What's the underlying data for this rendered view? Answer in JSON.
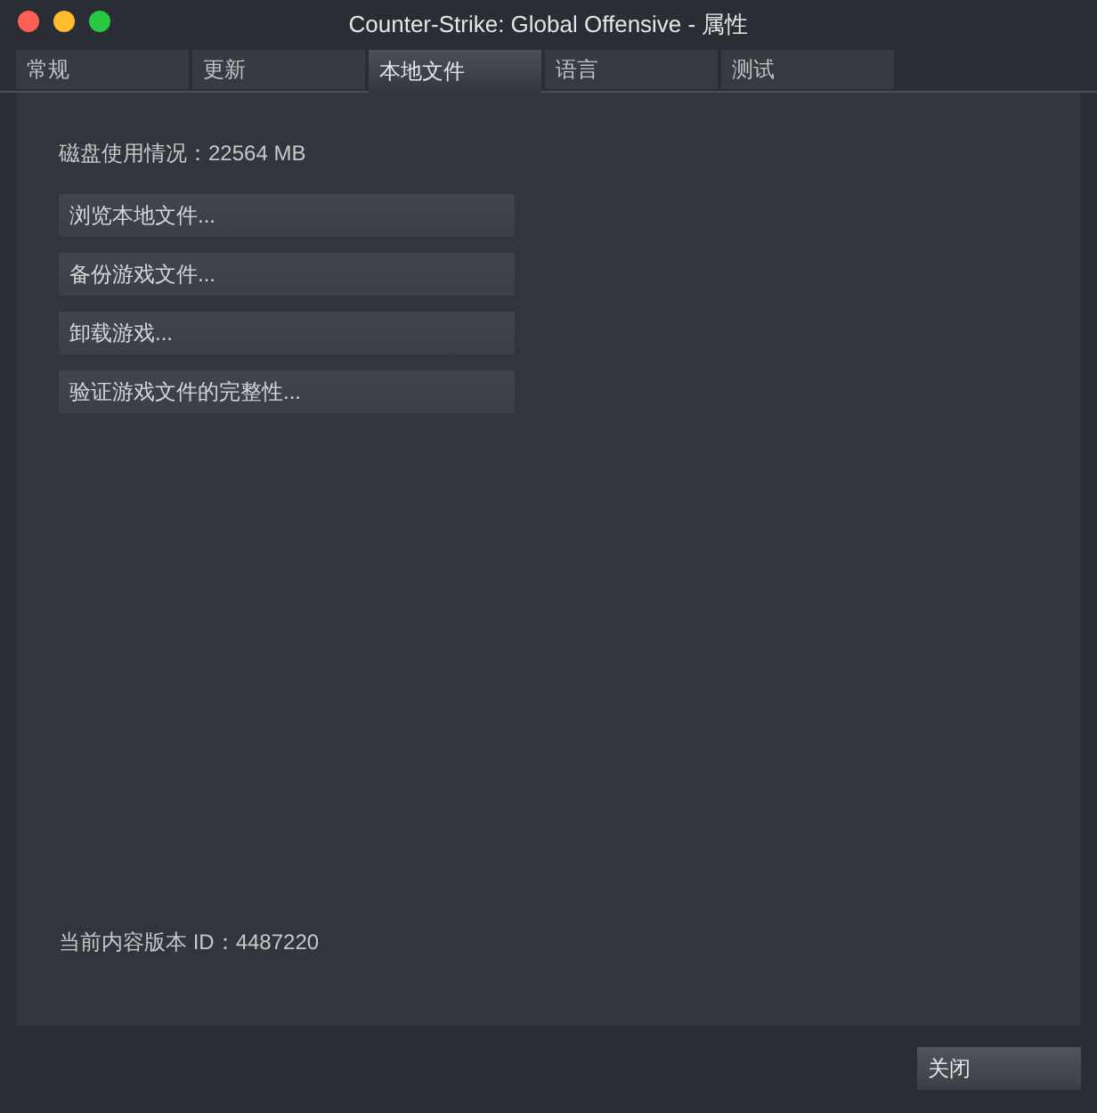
{
  "window": {
    "title": "Counter-Strike: Global Offensive - 属性"
  },
  "tabs": [
    {
      "label": "常规",
      "selected": false
    },
    {
      "label": "更新",
      "selected": false
    },
    {
      "label": "本地文件",
      "selected": true
    },
    {
      "label": "语言",
      "selected": false
    },
    {
      "label": "测试",
      "selected": false
    }
  ],
  "disk_usage": "磁盘使用情况：22564 MB",
  "actions": [
    "浏览本地文件...",
    "备份游戏文件...",
    "卸载游戏...",
    "验证游戏文件的完整性..."
  ],
  "content_version": "当前内容版本 ID：4487220",
  "close_button": "关闭"
}
